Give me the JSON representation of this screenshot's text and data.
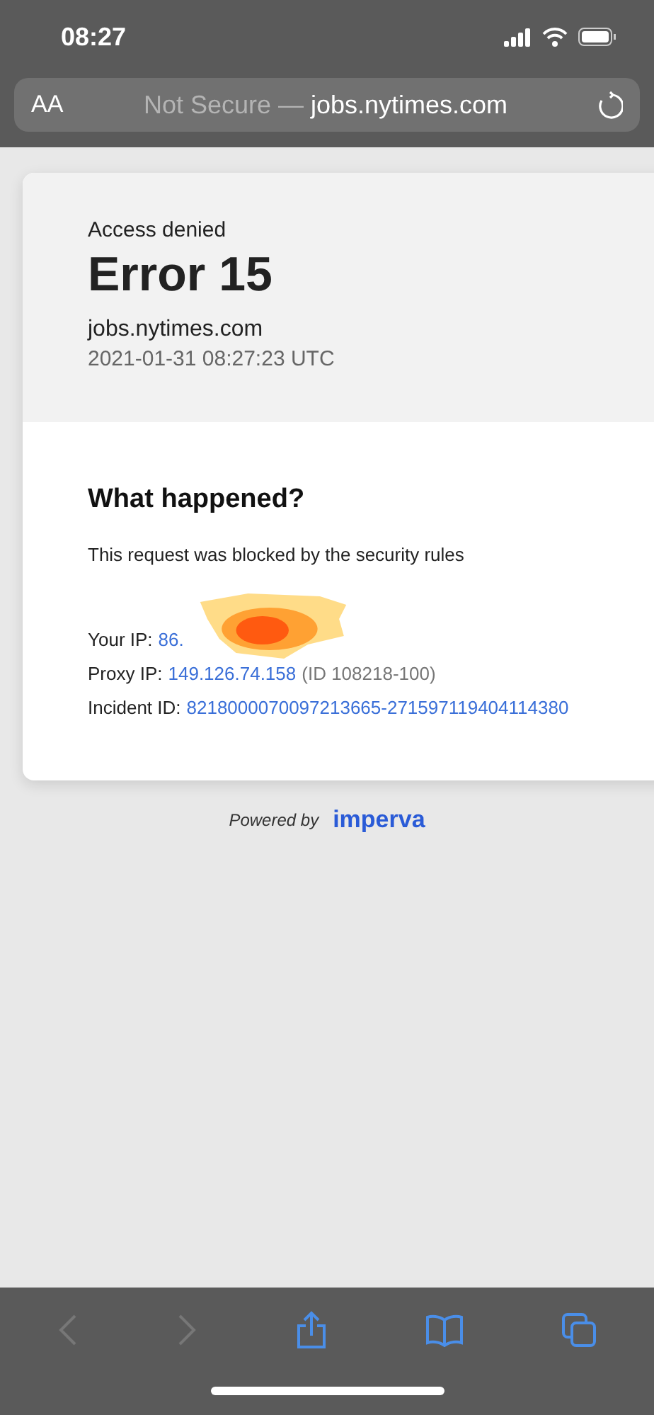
{
  "status_bar": {
    "time": "08:27"
  },
  "address_bar": {
    "text_size_button": "AA",
    "security_label": "Not Secure —",
    "domain": "jobs.nytimes.com"
  },
  "error_card": {
    "heading": "Access denied",
    "code": "Error 15",
    "site": "jobs.nytimes.com",
    "timestamp": "2021-01-31 08:27:23 UTC",
    "section_title": "What happened?",
    "message": "This request was blocked by the security rules",
    "details": [
      {
        "label": "Your IP:",
        "value": "86.",
        "redacted": true
      },
      {
        "label": "Proxy IP:",
        "value": "149.126.74.158",
        "note": "(ID 108218-100)",
        "redacted": false
      },
      {
        "label": "Incident ID:",
        "value": "8218000070097213665-271597119404114380",
        "redacted": false
      }
    ]
  },
  "footer": {
    "powered_by": "Powered by",
    "brand": "imperva"
  },
  "toolbar": [
    {
      "kind": "back",
      "disabled": true
    },
    {
      "kind": "forward",
      "disabled": true
    },
    {
      "kind": "share",
      "disabled": false
    },
    {
      "kind": "bookmarks",
      "disabled": false
    },
    {
      "kind": "tabs",
      "disabled": false
    }
  ]
}
